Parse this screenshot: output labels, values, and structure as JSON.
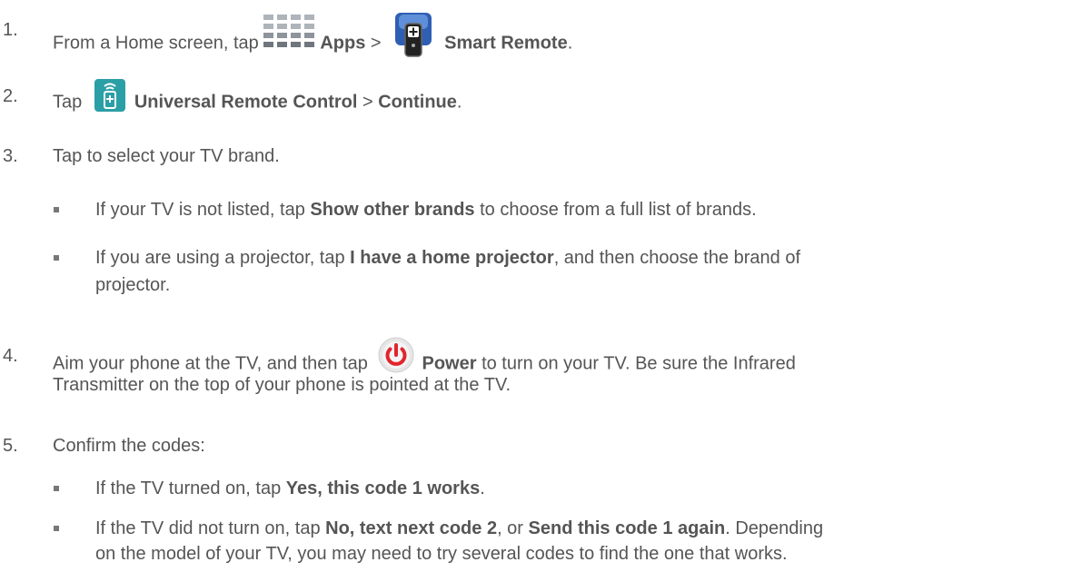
{
  "steps": [
    {
      "num": "1.",
      "pre": "From a Home screen, tap ",
      "b1": "Apps",
      "mid": " > ",
      "b2": "Smart Remote",
      "post": "."
    },
    {
      "num": "2.",
      "pre": "Tap ",
      "b1": "Universal Remote Control",
      "mid": " > ",
      "b2": "Continue",
      "post": "."
    },
    {
      "num": "3.",
      "text": "Tap to select your TV brand."
    },
    {
      "num": "4.",
      "pre": "Aim your phone at the TV, and then tap ",
      "b1": "Power",
      "post": " to turn on your TV. Be sure the Infrared",
      "line2": "Transmitter on the top of your phone is pointed at the TV."
    },
    {
      "num": "5.",
      "text": "Confirm the codes:"
    }
  ],
  "bullets3": [
    {
      "pre": "If your TV is not listed, tap ",
      "b1": "Show other brands",
      "post": " to choose from a full list of brands."
    },
    {
      "pre": "If you are using a projector, tap ",
      "b1": "I have a home projector",
      "post": ", and then choose the brand of",
      "line2": "projector."
    }
  ],
  "bullets5": [
    {
      "pre": "If the TV turned on, tap ",
      "b1": "Yes, this code 1 works",
      "post": "."
    },
    {
      "pre": "If the TV did not turn on, tap ",
      "b1": "No, text next code 2",
      "mid": ", or ",
      "b2": "Send this code 1 again",
      "post": ". Depending",
      "line2": "on the model of your TV, you may need to try several codes to find the one that works."
    }
  ],
  "icons": [
    "apps-grid-icon",
    "smart-remote-icon",
    "universal-remote-icon",
    "power-icon"
  ]
}
